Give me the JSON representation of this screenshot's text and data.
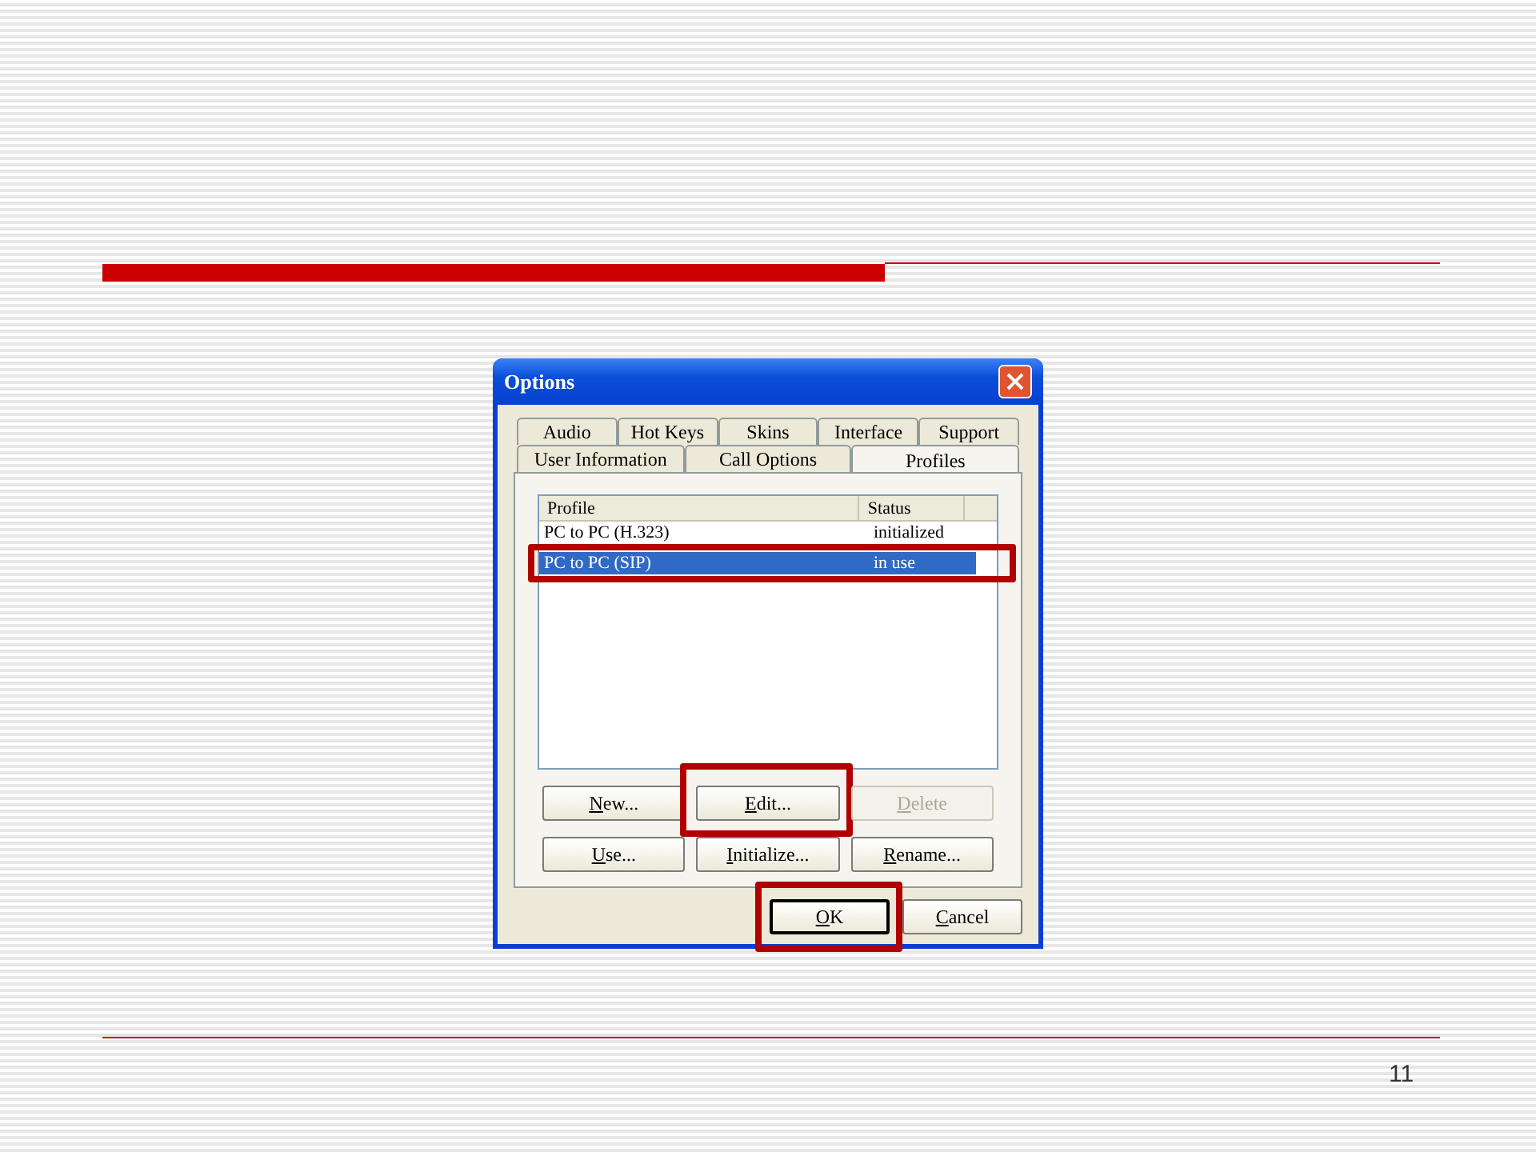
{
  "slide": {
    "page_number": "11"
  },
  "dialog": {
    "title": "Options",
    "tab_rows": [
      [
        {
          "label": "Audio",
          "selected": false
        },
        {
          "label": "Hot Keys",
          "selected": false
        },
        {
          "label": "Skins",
          "selected": false
        },
        {
          "label": "Interface",
          "selected": false
        },
        {
          "label": "Support",
          "selected": false
        }
      ],
      [
        {
          "label": "User Information",
          "selected": false
        },
        {
          "label": "Call Options",
          "selected": false
        },
        {
          "label": "Profiles",
          "selected": true
        }
      ]
    ],
    "list": {
      "columns": [
        "Profile",
        "Status"
      ],
      "rows": [
        {
          "profile": "PC to PC (H.323)",
          "status": "initialized",
          "selected": false,
          "highlighted": false
        },
        {
          "profile": "PC to PC (SIP)",
          "status": "in use",
          "selected": true,
          "highlighted": true
        }
      ]
    },
    "buttons": [
      {
        "label": "New...",
        "disabled": false,
        "highlighted": false
      },
      {
        "label": "Edit...",
        "disabled": false,
        "highlighted": true
      },
      {
        "label": "Delete",
        "disabled": true,
        "highlighted": false
      },
      {
        "label": "Use...",
        "disabled": false,
        "highlighted": false
      },
      {
        "label": "Initialize...",
        "disabled": false,
        "highlighted": false
      },
      {
        "label": "Rename...",
        "disabled": false,
        "highlighted": false
      }
    ],
    "footer_buttons": [
      {
        "label": "OK",
        "default": true,
        "highlighted": true
      },
      {
        "label": "Cancel",
        "default": false,
        "highlighted": false
      }
    ]
  }
}
